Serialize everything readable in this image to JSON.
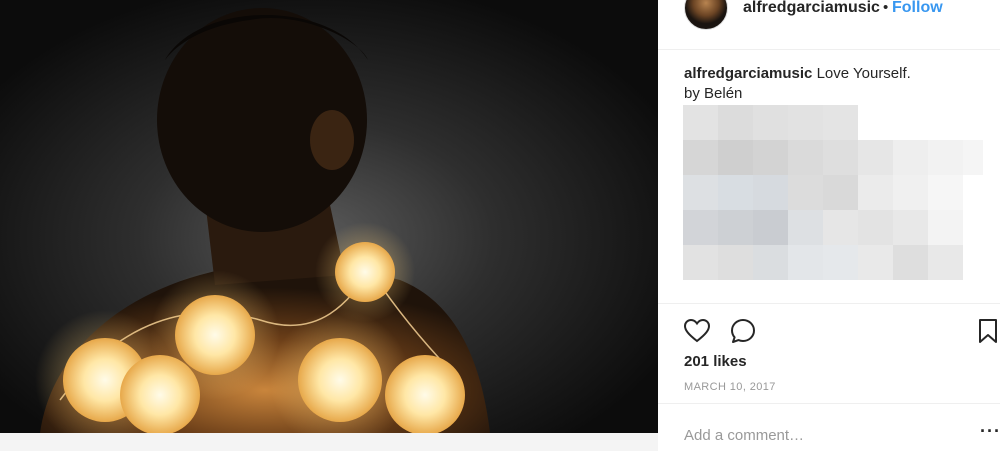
{
  "post": {
    "username": "alfredgarciamusic",
    "separator": "•",
    "follow_label": "Follow",
    "caption": {
      "username": "alfredgarciamusic",
      "line1": "Love Yourself.",
      "line2": "by Belén"
    },
    "likes": "201 likes",
    "date": "MARCH 10, 2017",
    "comment_placeholder": "Add a comment…",
    "more_label": "···",
    "icons": {
      "like": "heart-icon",
      "comment": "comment-icon",
      "save": "bookmark-icon",
      "more": "more-options-icon"
    },
    "colors": {
      "accent": "#3897f0",
      "text": "#262626",
      "muted": "#999999",
      "divider": "#efefef"
    }
  }
}
